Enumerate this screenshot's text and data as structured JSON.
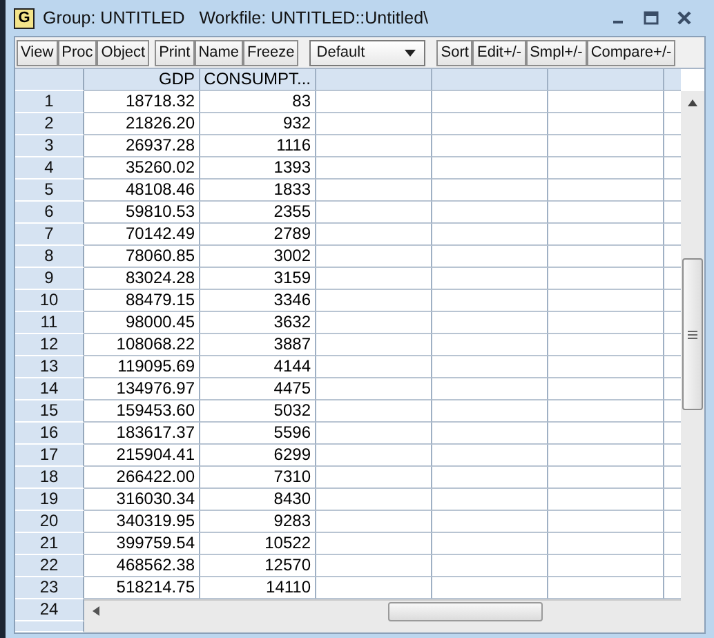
{
  "window": {
    "icon_letter": "G",
    "title": "Group: UNTITLED   Workfile: UNTITLED::Untitled\\"
  },
  "toolbar": {
    "groups": [
      [
        "View",
        "Proc",
        "Object"
      ],
      [
        "Print",
        "Name",
        "Freeze"
      ]
    ],
    "dropdown": {
      "value": "Default"
    },
    "groups_after": [
      [
        "Sort",
        "Edit+/-",
        "Smpl+/-",
        "Compare+/-"
      ]
    ]
  },
  "table": {
    "columns": [
      "GDP",
      "CONSUMPT..."
    ],
    "rows": [
      {
        "label": "1",
        "cells": [
          "18718.32",
          "83"
        ]
      },
      {
        "label": "2",
        "cells": [
          "21826.20",
          "932"
        ]
      },
      {
        "label": "3",
        "cells": [
          "26937.28",
          "1116"
        ]
      },
      {
        "label": "4",
        "cells": [
          "35260.02",
          "1393"
        ]
      },
      {
        "label": "5",
        "cells": [
          "48108.46",
          "1833"
        ]
      },
      {
        "label": "6",
        "cells": [
          "59810.53",
          "2355"
        ]
      },
      {
        "label": "7",
        "cells": [
          "70142.49",
          "2789"
        ]
      },
      {
        "label": "8",
        "cells": [
          "78060.85",
          "3002"
        ]
      },
      {
        "label": "9",
        "cells": [
          "83024.28",
          "3159"
        ]
      },
      {
        "label": "10",
        "cells": [
          "88479.15",
          "3346"
        ]
      },
      {
        "label": "11",
        "cells": [
          "98000.45",
          "3632"
        ]
      },
      {
        "label": "12",
        "cells": [
          "108068.22",
          "3887"
        ]
      },
      {
        "label": "13",
        "cells": [
          "119095.69",
          "4144"
        ]
      },
      {
        "label": "14",
        "cells": [
          "134976.97",
          "4475"
        ]
      },
      {
        "label": "15",
        "cells": [
          "159453.60",
          "5032"
        ]
      },
      {
        "label": "16",
        "cells": [
          "183617.37",
          "5596"
        ]
      },
      {
        "label": "17",
        "cells": [
          "215904.41",
          "6299"
        ]
      },
      {
        "label": "18",
        "cells": [
          "266422.00",
          "7310"
        ]
      },
      {
        "label": "19",
        "cells": [
          "316030.34",
          "8430"
        ]
      },
      {
        "label": "20",
        "cells": [
          "340319.95",
          "9283"
        ]
      },
      {
        "label": "21",
        "cells": [
          "399759.54",
          "10522"
        ]
      },
      {
        "label": "22",
        "cells": [
          "468562.38",
          "12570"
        ]
      },
      {
        "label": "23",
        "cells": [
          "518214.75",
          "14110"
        ]
      }
    ],
    "last_row_label": "24"
  }
}
